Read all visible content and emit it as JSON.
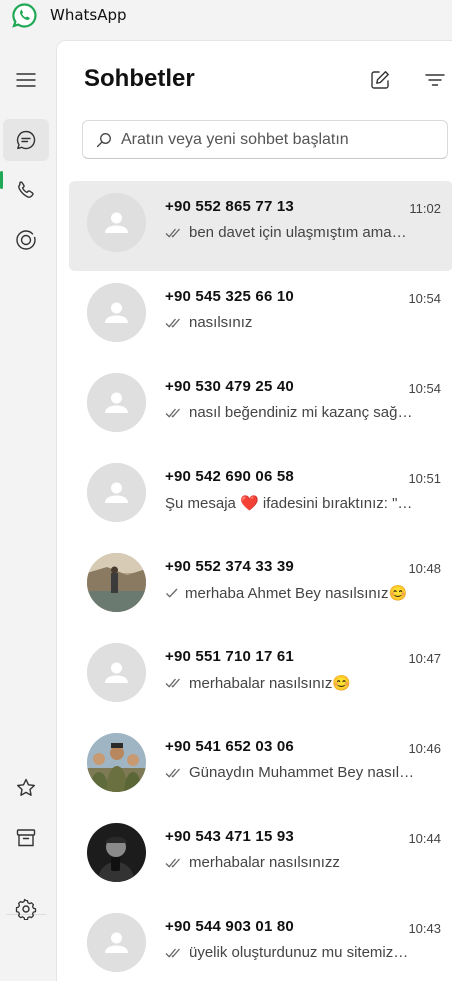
{
  "app": {
    "title": "WhatsApp"
  },
  "header": {
    "title": "Sohbetler"
  },
  "search": {
    "placeholder": "Aratın veya yeni sohbet başlatın"
  },
  "colors": {
    "accent": "#1fa855",
    "selected_row": "#ebebeb",
    "avatar_placeholder": "#dfdfdf"
  },
  "rail": {
    "icons": [
      "menu-icon",
      "chats-icon",
      "calls-icon",
      "status-icon",
      "starred-icon",
      "archive-icon",
      "settings-icon"
    ]
  },
  "chats": [
    {
      "name": "+90 552 865 77 13",
      "time": "11:02",
      "message": "ben davet için ulaşmıştım ama…",
      "tick": "double",
      "avatar": "placeholder"
    },
    {
      "name": "+90 545 325 66 10",
      "time": "10:54",
      "message": "nasılsınız",
      "tick": "double",
      "avatar": "placeholder"
    },
    {
      "name": "+90 530 479 25 40",
      "time": "10:54",
      "message": "nasıl beğendiniz mi kazanç sağ…",
      "tick": "double",
      "avatar": "placeholder"
    },
    {
      "name": "+90 542 690 06 58",
      "time": "10:51",
      "message": "Şu mesaja ❤️ ifadesini bıraktınız: \"…",
      "tick": "none",
      "avatar": "placeholder"
    },
    {
      "name": "+90 552 374 33 39",
      "time": "10:48",
      "message": "merhaba Ahmet Bey nasılsınız😊",
      "tick": "single",
      "avatar": "photo-lake"
    },
    {
      "name": "+90 551 710 17 61",
      "time": "10:47",
      "message": "merhabalar nasılsınız😊",
      "tick": "double",
      "avatar": "placeholder"
    },
    {
      "name": "+90 541 652 03 06",
      "time": "10:46",
      "message": "Günaydın Muhammet Bey nasıl…",
      "tick": "double",
      "avatar": "photo-group"
    },
    {
      "name": "+90 543 471 15 93",
      "time": "10:44",
      "message": "merhabalar nasılsınızz",
      "tick": "double",
      "avatar": "photo-dark"
    },
    {
      "name": "+90 544 903 01 80",
      "time": "10:43",
      "message": "üyelik oluşturdunuz mu sitemiz…",
      "tick": "double",
      "avatar": "placeholder"
    }
  ]
}
